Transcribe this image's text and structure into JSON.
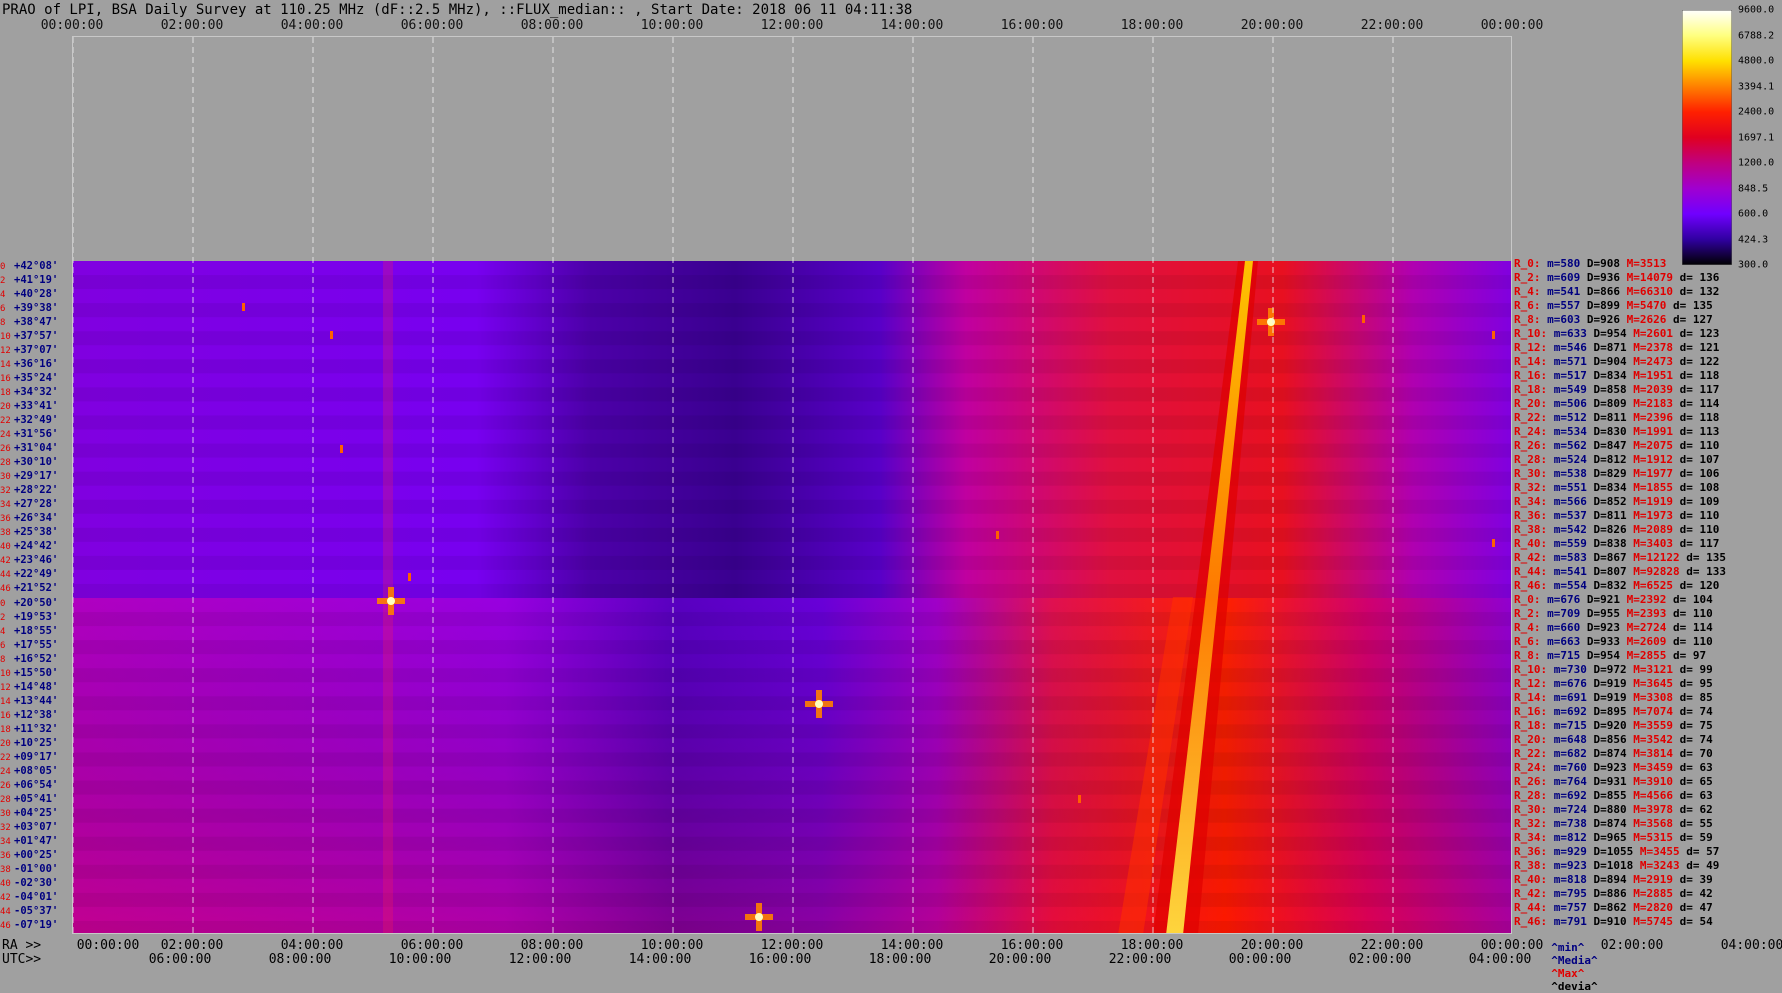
{
  "title": "PRAO of LPI, BSA Daily Survey at 110.25 MHz (dF::2.5 MHz), ::FLUX_median:: , Start Date: 2018 06 11 04:11:38",
  "utc_top_ticks": [
    "00:00:00",
    "02:00:00",
    "04:00:00",
    "06:00:00",
    "08:00:00",
    "10:00:00",
    "12:00:00",
    "14:00:00",
    "16:00:00",
    "18:00:00",
    "20:00:00",
    "22:00:00",
    "00:00:00"
  ],
  "ra_label": "RA >>",
  "utc_label": "UTC>>",
  "ra_ticks": [
    "00:00:00",
    "02:00:00",
    "04:00:00",
    "06:00:00",
    "08:00:00",
    "10:00:00",
    "12:00:00",
    "14:00:00",
    "16:00:00",
    "18:00:00",
    "20:00:00",
    "22:00:00",
    "00:00:00",
    "02:00:00",
    "04:00:00"
  ],
  "utc_bottom_ticks": [
    "06:00:00",
    "08:00:00",
    "10:00:00",
    "12:00:00",
    "14:00:00",
    "16:00:00",
    "18:00:00",
    "20:00:00",
    "22:00:00",
    "00:00:00",
    "02:00:00",
    "04:00:00"
  ],
  "colorbar": {
    "values": [
      "9600.0",
      "6788.2",
      "4800.0",
      "3394.1",
      "2400.0",
      "1697.1",
      "1200.0",
      "848.5",
      "600.0",
      "424.3",
      "300.0"
    ],
    "colors": [
      "#ffffff",
      "#ffff80",
      "#ffe000",
      "#ff8000",
      "#ff2000",
      "#e00020",
      "#c00080",
      "#a000d0",
      "#7000ff",
      "#3000a0",
      "#000000"
    ]
  },
  "rows": [
    {
      "idx": "0",
      "dec": "+42°08'"
    },
    {
      "idx": "2",
      "dec": "+41°19'"
    },
    {
      "idx": "4",
      "dec": "+40°28'"
    },
    {
      "idx": "6",
      "dec": "+39°38'"
    },
    {
      "idx": "8",
      "dec": "+38°47'"
    },
    {
      "idx": "10",
      "dec": "+37°57'"
    },
    {
      "idx": "12",
      "dec": "+37°07'"
    },
    {
      "idx": "14",
      "dec": "+36°16'"
    },
    {
      "idx": "16",
      "dec": "+35°24'"
    },
    {
      "idx": "18",
      "dec": "+34°32'"
    },
    {
      "idx": "20",
      "dec": "+33°41'"
    },
    {
      "idx": "22",
      "dec": "+32°49'"
    },
    {
      "idx": "24",
      "dec": "+31°56'"
    },
    {
      "idx": "26",
      "dec": "+31°04'"
    },
    {
      "idx": "28",
      "dec": "+30°10'"
    },
    {
      "idx": "30",
      "dec": "+29°17'"
    },
    {
      "idx": "32",
      "dec": "+28°22'"
    },
    {
      "idx": "34",
      "dec": "+27°28'"
    },
    {
      "idx": "36",
      "dec": "+26°34'"
    },
    {
      "idx": "38",
      "dec": "+25°38'"
    },
    {
      "idx": "40",
      "dec": "+24°42'"
    },
    {
      "idx": "42",
      "dec": "+23°46'"
    },
    {
      "idx": "44",
      "dec": "+22°49'"
    },
    {
      "idx": "46",
      "dec": "+21°52'"
    },
    {
      "idx": "0",
      "dec": "+20°50'"
    },
    {
      "idx": "2",
      "dec": "+19°53'"
    },
    {
      "idx": "4",
      "dec": "+18°55'"
    },
    {
      "idx": "6",
      "dec": "+17°55'"
    },
    {
      "idx": "8",
      "dec": "+16°52'"
    },
    {
      "idx": "10",
      "dec": "+15°50'"
    },
    {
      "idx": "12",
      "dec": "+14°48'"
    },
    {
      "idx": "14",
      "dec": "+13°44'"
    },
    {
      "idx": "16",
      "dec": "+12°38'"
    },
    {
      "idx": "18",
      "dec": "+11°32'"
    },
    {
      "idx": "20",
      "dec": "+10°25'"
    },
    {
      "idx": "22",
      "dec": "+09°17'"
    },
    {
      "idx": "24",
      "dec": "+08°05'"
    },
    {
      "idx": "26",
      "dec": "+06°54'"
    },
    {
      "idx": "28",
      "dec": "+05°41'"
    },
    {
      "idx": "30",
      "dec": "+04°25'"
    },
    {
      "idx": "32",
      "dec": "+03°07'"
    },
    {
      "idx": "34",
      "dec": "+01°47'"
    },
    {
      "idx": "36",
      "dec": "+00°25'"
    },
    {
      "idx": "38",
      "dec": "-01°00'"
    },
    {
      "idx": "40",
      "dec": "-02°30'"
    },
    {
      "idx": "42",
      "dec": "-04°01'"
    },
    {
      "idx": "44",
      "dec": "-05°37'"
    },
    {
      "idx": "46",
      "dec": "-07°19'"
    }
  ],
  "stats": [
    {
      "r": "R_0:",
      "m": "m=580",
      "D": "D=908",
      "M": "M=3513",
      "d": ""
    },
    {
      "r": "R_2:",
      "m": "m=609",
      "D": "D=936",
      "M": "M=14079",
      "d": "d= 136"
    },
    {
      "r": "R_4:",
      "m": "m=541",
      "D": "D=866",
      "M": "M=66310",
      "d": "d= 132"
    },
    {
      "r": "R_6:",
      "m": "m=557",
      "D": "D=899",
      "M": "M=5470",
      "d": "d= 135"
    },
    {
      "r": "R_8:",
      "m": "m=603",
      "D": "D=926",
      "M": "M=2626",
      "d": "d= 127"
    },
    {
      "r": "R_10:",
      "m": "m=633",
      "D": "D=954",
      "M": "M=2601",
      "d": "d= 123"
    },
    {
      "r": "R_12:",
      "m": "m=546",
      "D": "D=871",
      "M": "M=2378",
      "d": "d= 121"
    },
    {
      "r": "R_14:",
      "m": "m=571",
      "D": "D=904",
      "M": "M=2473",
      "d": "d= 122"
    },
    {
      "r": "R_16:",
      "m": "m=517",
      "D": "D=834",
      "M": "M=1951",
      "d": "d= 118"
    },
    {
      "r": "R_18:",
      "m": "m=549",
      "D": "D=858",
      "M": "M=2039",
      "d": "d= 117"
    },
    {
      "r": "R_20:",
      "m": "m=506",
      "D": "D=809",
      "M": "M=2183",
      "d": "d= 114"
    },
    {
      "r": "R_22:",
      "m": "m=512",
      "D": "D=811",
      "M": "M=2396",
      "d": "d= 118"
    },
    {
      "r": "R_24:",
      "m": "m=534",
      "D": "D=830",
      "M": "M=1991",
      "d": "d= 113"
    },
    {
      "r": "R_26:",
      "m": "m=562",
      "D": "D=847",
      "M": "M=2075",
      "d": "d= 110"
    },
    {
      "r": "R_28:",
      "m": "m=524",
      "D": "D=812",
      "M": "M=1912",
      "d": "d= 107"
    },
    {
      "r": "R_30:",
      "m": "m=538",
      "D": "D=829",
      "M": "M=1977",
      "d": "d= 106"
    },
    {
      "r": "R_32:",
      "m": "m=551",
      "D": "D=834",
      "M": "M=1855",
      "d": "d= 108"
    },
    {
      "r": "R_34:",
      "m": "m=566",
      "D": "D=852",
      "M": "M=1919",
      "d": "d= 109"
    },
    {
      "r": "R_36:",
      "m": "m=537",
      "D": "D=811",
      "M": "M=1973",
      "d": "d= 110"
    },
    {
      "r": "R_38:",
      "m": "m=542",
      "D": "D=826",
      "M": "M=2089",
      "d": "d= 110"
    },
    {
      "r": "R_40:",
      "m": "m=559",
      "D": "D=838",
      "M": "M=3403",
      "d": "d= 117"
    },
    {
      "r": "R_42:",
      "m": "m=583",
      "D": "D=867",
      "M": "M=12122",
      "d": "d= 135"
    },
    {
      "r": "R_44:",
      "m": "m=541",
      "D": "D=807",
      "M": "M=92828",
      "d": "d= 133"
    },
    {
      "r": "R_46:",
      "m": "m=554",
      "D": "D=832",
      "M": "M=6525",
      "d": "d= 120"
    },
    {
      "r": "R_0:",
      "m": "m=676",
      "D": "D=921",
      "M": "M=2392",
      "d": "d= 104"
    },
    {
      "r": "R_2:",
      "m": "m=709",
      "D": "D=955",
      "M": "M=2393",
      "d": "d= 110"
    },
    {
      "r": "R_4:",
      "m": "m=660",
      "D": "D=923",
      "M": "M=2724",
      "d": "d= 114"
    },
    {
      "r": "R_6:",
      "m": "m=663",
      "D": "D=933",
      "M": "M=2609",
      "d": "d= 110"
    },
    {
      "r": "R_8:",
      "m": "m=715",
      "D": "D=954",
      "M": "M=2855",
      "d": "d= 97"
    },
    {
      "r": "R_10:",
      "m": "m=730",
      "D": "D=972",
      "M": "M=3121",
      "d": "d= 99"
    },
    {
      "r": "R_12:",
      "m": "m=676",
      "D": "D=919",
      "M": "M=3645",
      "d": "d= 95"
    },
    {
      "r": "R_14:",
      "m": "m=691",
      "D": "D=919",
      "M": "M=3308",
      "d": "d= 85"
    },
    {
      "r": "R_16:",
      "m": "m=692",
      "D": "D=895",
      "M": "M=7074",
      "d": "d= 74"
    },
    {
      "r": "R_18:",
      "m": "m=715",
      "D": "D=920",
      "M": "M=3559",
      "d": "d= 75"
    },
    {
      "r": "R_20:",
      "m": "m=648",
      "D": "D=856",
      "M": "M=3542",
      "d": "d= 74"
    },
    {
      "r": "R_22:",
      "m": "m=682",
      "D": "D=874",
      "M": "M=3814",
      "d": "d= 70"
    },
    {
      "r": "R_24:",
      "m": "m=760",
      "D": "D=923",
      "M": "M=3459",
      "d": "d= 63"
    },
    {
      "r": "R_26:",
      "m": "m=764",
      "D": "D=931",
      "M": "M=3910",
      "d": "d= 65"
    },
    {
      "r": "R_28:",
      "m": "m=692",
      "D": "D=855",
      "M": "M=4566",
      "d": "d= 63"
    },
    {
      "r": "R_30:",
      "m": "m=724",
      "D": "D=880",
      "M": "M=3978",
      "d": "d= 62"
    },
    {
      "r": "R_32:",
      "m": "m=738",
      "D": "D=874",
      "M": "M=3568",
      "d": "d= 55"
    },
    {
      "r": "R_34:",
      "m": "m=812",
      "D": "D=965",
      "M": "M=5315",
      "d": "d= 59"
    },
    {
      "r": "R_36:",
      "m": "m=929",
      "D": "D=1055",
      "M": "M=3455",
      "d": "d= 57"
    },
    {
      "r": "R_38:",
      "m": "m=923",
      "D": "D=1018",
      "M": "M=3243",
      "d": "d= 49"
    },
    {
      "r": "R_40:",
      "m": "m=818",
      "D": "D=894",
      "M": "M=2919",
      "d": "d= 39"
    },
    {
      "r": "R_42:",
      "m": "m=795",
      "D": "D=886",
      "M": "M=2885",
      "d": "d= 42"
    },
    {
      "r": "R_44:",
      "m": "m=757",
      "D": "D=862",
      "M": "M=2820",
      "d": "d= 47"
    },
    {
      "r": "R_46:",
      "m": "m=791",
      "D": "D=910",
      "M": "M=5745",
      "d": "d= 54"
    }
  ],
  "legend": {
    "min": "^min^",
    "media": "^Media^",
    "max": "^Max^",
    "devia": "^devia^"
  }
}
